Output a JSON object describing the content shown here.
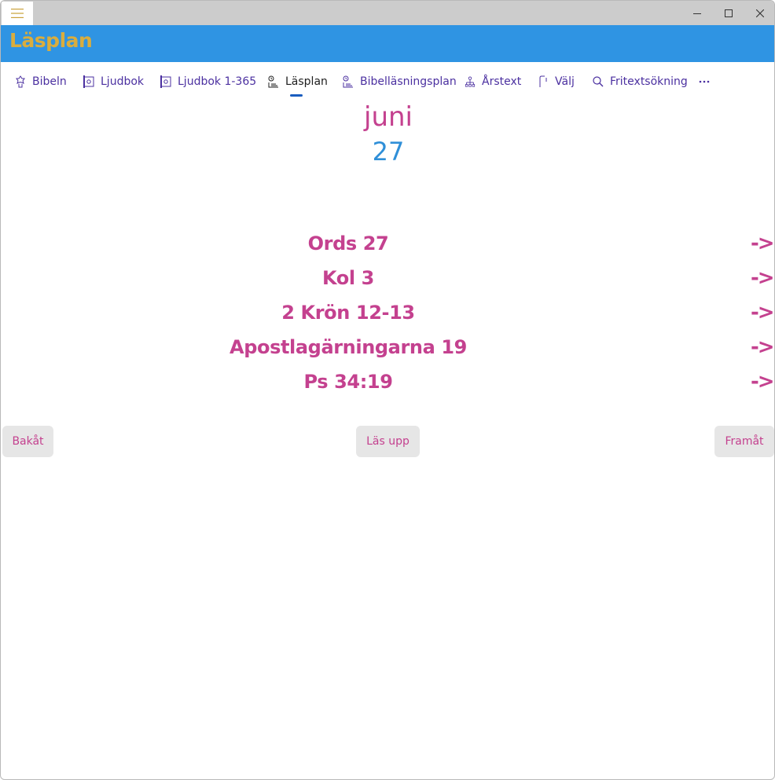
{
  "app": {
    "title": "Läsplan"
  },
  "titlebar": {
    "menu_icon": "hamburger-icon",
    "minimize_icon": "minimize-icon",
    "maximize_icon": "maximize-icon",
    "close_icon": "close-icon"
  },
  "nav": {
    "items": [
      {
        "label": "Bibeln",
        "icon": "bible-icon"
      },
      {
        "label": "Ljudbok",
        "icon": "audiobook-icon"
      },
      {
        "label": "Ljudbok 1-365",
        "icon": "audiobook-icon"
      },
      {
        "label": "Läsplan",
        "icon": "reading-plan-icon",
        "active": true
      },
      {
        "label": "Bibelläsningsplan",
        "icon": "reading-plan-icon"
      },
      {
        "label": "Årstext",
        "icon": "tree-icon"
      },
      {
        "label": "Välj",
        "icon": "select-icon"
      },
      {
        "label": "Fritextsökning",
        "icon": "search-icon"
      }
    ],
    "more_icon": "more-icon"
  },
  "date": {
    "month": "juni",
    "day": "27"
  },
  "readings": [
    {
      "text": "Ords 27",
      "arrow": "->"
    },
    {
      "text": "Kol 3",
      "arrow": "->"
    },
    {
      "text": "2 Krön 12-13",
      "arrow": "->"
    },
    {
      "text": "Apostlagärningarna 19",
      "arrow": "->"
    },
    {
      "text": "Ps 34:19",
      "arrow": "->"
    }
  ],
  "buttons": {
    "back": "Bakåt",
    "read_aloud": "Läs upp",
    "forward": "Framåt"
  },
  "colors": {
    "header_bg": "#2f94e3",
    "title": "#d9ad3e",
    "accent_pink": "#c4418f",
    "day_blue": "#2f8fd8",
    "nav_text": "#4b30a0",
    "button_bg": "#e6e6e6"
  }
}
